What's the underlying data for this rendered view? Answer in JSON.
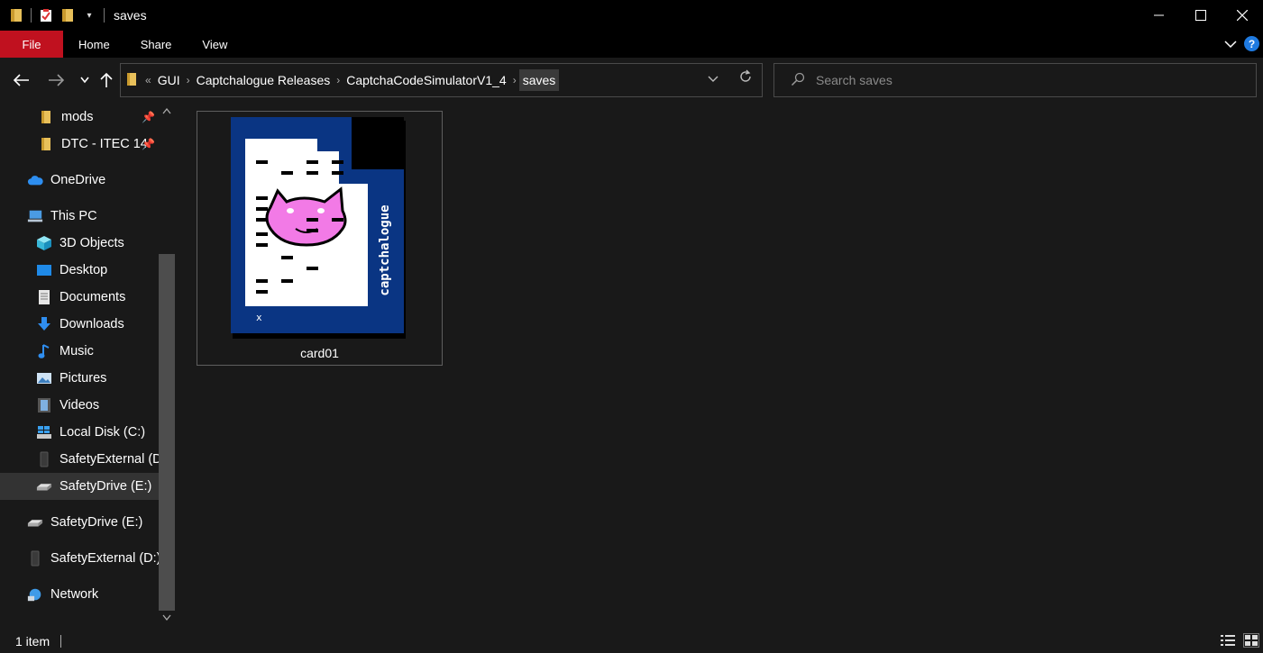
{
  "window": {
    "title": "saves",
    "controls": [
      "minimize",
      "maximize",
      "close"
    ]
  },
  "ribbon": {
    "tabs": [
      "File",
      "Home",
      "Share",
      "View"
    ]
  },
  "address": {
    "overflow": "«",
    "crumbs": [
      "GUI",
      "Captchalogue Releases",
      "CaptchaCodeSimulatorV1_4",
      "saves"
    ]
  },
  "search": {
    "placeholder": "Search saves"
  },
  "sidebar": {
    "items": [
      {
        "label": "mods",
        "icon": "folder-icon",
        "pinned": true
      },
      {
        "label": "DTC - ITEC 14",
        "icon": "folder-icon",
        "pinned": true
      },
      {
        "label": "OneDrive",
        "icon": "cloud-icon"
      },
      {
        "label": "This PC",
        "icon": "computer-icon"
      },
      {
        "label": "3D Objects",
        "icon": "cube-icon"
      },
      {
        "label": "Desktop",
        "icon": "desktop-icon"
      },
      {
        "label": "Documents",
        "icon": "document-icon"
      },
      {
        "label": "Downloads",
        "icon": "download-icon"
      },
      {
        "label": "Music",
        "icon": "music-icon"
      },
      {
        "label": "Pictures",
        "icon": "picture-icon"
      },
      {
        "label": "Videos",
        "icon": "video-icon"
      },
      {
        "label": "Local Disk (C:)",
        "icon": "windows-drive-icon"
      },
      {
        "label": "SafetyExternal (D:)",
        "icon": "external-drive-icon"
      },
      {
        "label": "SafetyDrive (E:)",
        "icon": "usb-drive-icon",
        "selected": true
      },
      {
        "label": "SafetyDrive (E:)",
        "icon": "usb-drive-icon"
      },
      {
        "label": "SafetyExternal (D:)",
        "icon": "external-drive-icon"
      },
      {
        "label": "Network",
        "icon": "network-icon"
      }
    ]
  },
  "files": [
    {
      "name": "card01",
      "thumbnail_text": "captchalogue",
      "thumbnail_mark": "x"
    }
  ],
  "status": {
    "count": "1 item"
  },
  "colors": {
    "file_tab": "#c0111f",
    "card_blue": "#0a3583",
    "cat_pink": "#f27ae6"
  }
}
